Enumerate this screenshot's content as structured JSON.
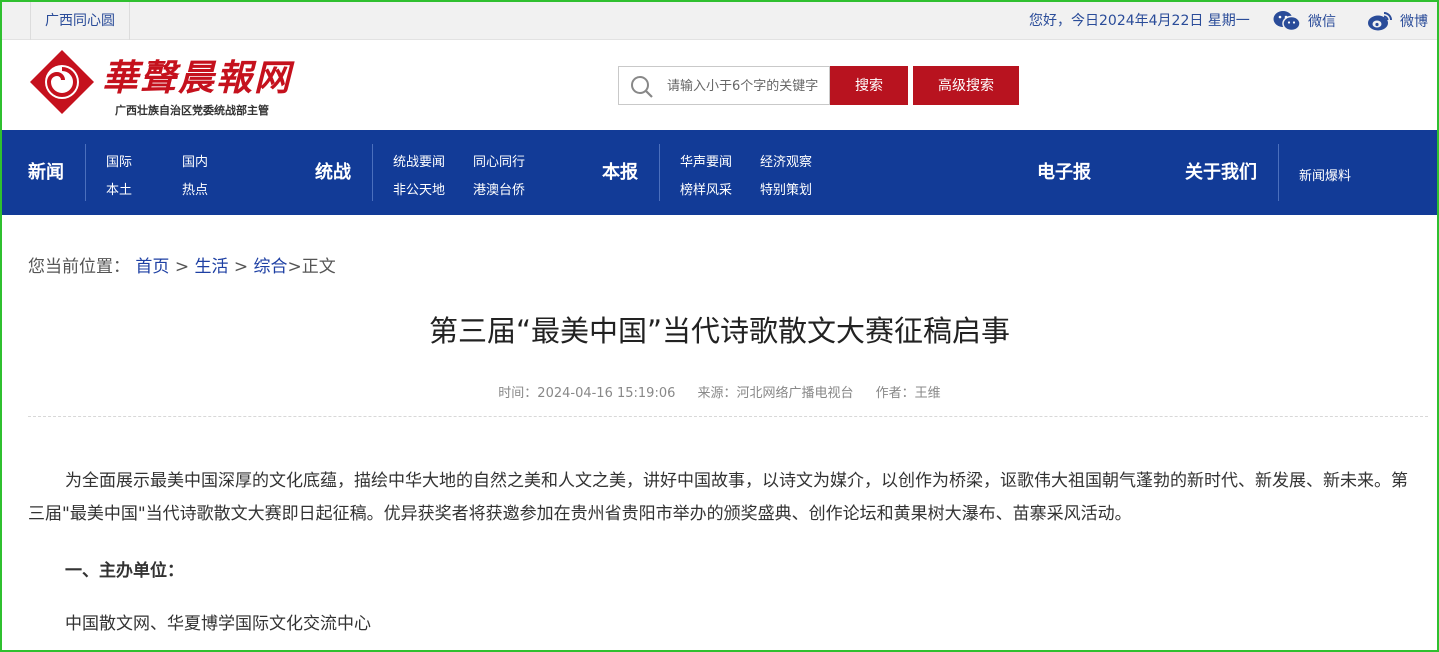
{
  "topbar": {
    "site_link": "广西同心圆",
    "greeting": "您好，今日2024年4月22日 星期一",
    "wechat": "微信",
    "weibo": "微博",
    "wechat_icon": "wechat-icon",
    "weibo_icon": "weibo-icon"
  },
  "logo": {
    "title": "華聲晨報网",
    "subtitle": "广西壮族自治区党委统战部主管"
  },
  "search": {
    "placeholder": "请输入小于6个字的关键字",
    "search_label": "搜索",
    "advanced_label": "高级搜索"
  },
  "nav": {
    "news": {
      "label": "新闻",
      "items": [
        "国际",
        "国内",
        "本土",
        "热点"
      ]
    },
    "united_front": {
      "label": "统战",
      "items": [
        "统战要闻",
        "同心同行",
        "非公天地",
        "港澳台侨"
      ]
    },
    "paper": {
      "label": "本报",
      "items": [
        "华声要闻",
        "经济观察",
        "榜样风采",
        "特别策划"
      ]
    },
    "epaper": "电子报",
    "about": "关于我们",
    "tips": "新闻爆料"
  },
  "breadcrumb": {
    "prefix": "您当前位置：",
    "home": "首页",
    "life": "生活",
    "general": "综合",
    "current": "正文",
    "sep": ">"
  },
  "article": {
    "title": "第三届“最美中国”当代诗歌散文大赛征稿启事",
    "time": "时间：2024-04-16 15:19:06",
    "source": "来源：河北网络广播电视台",
    "author": "作者：王维",
    "p1": "为全面展示最美中国深厚的文化底蕴，描绘中华大地的自然之美和人文之美，讲好中国故事，以诗文为媒介，以创作为桥梁，讴歌伟大祖国朝气蓬勃的新时代、新发展、新未来。第三届\"最美中国\"当代诗歌散文大赛即日起征稿。优异获奖者将获邀参加在贵州省贵阳市举办的颁奖盛典、创作论坛和黄果树大瀑布、苗寨采风活动。",
    "heading1": "一、主办单位：",
    "p2": "中国散文网、华夏博学国际文化交流中心"
  },
  "colors": {
    "brand_red": "#b8131f",
    "nav_blue": "#123b97",
    "link_blue": "#1d3fa3"
  }
}
